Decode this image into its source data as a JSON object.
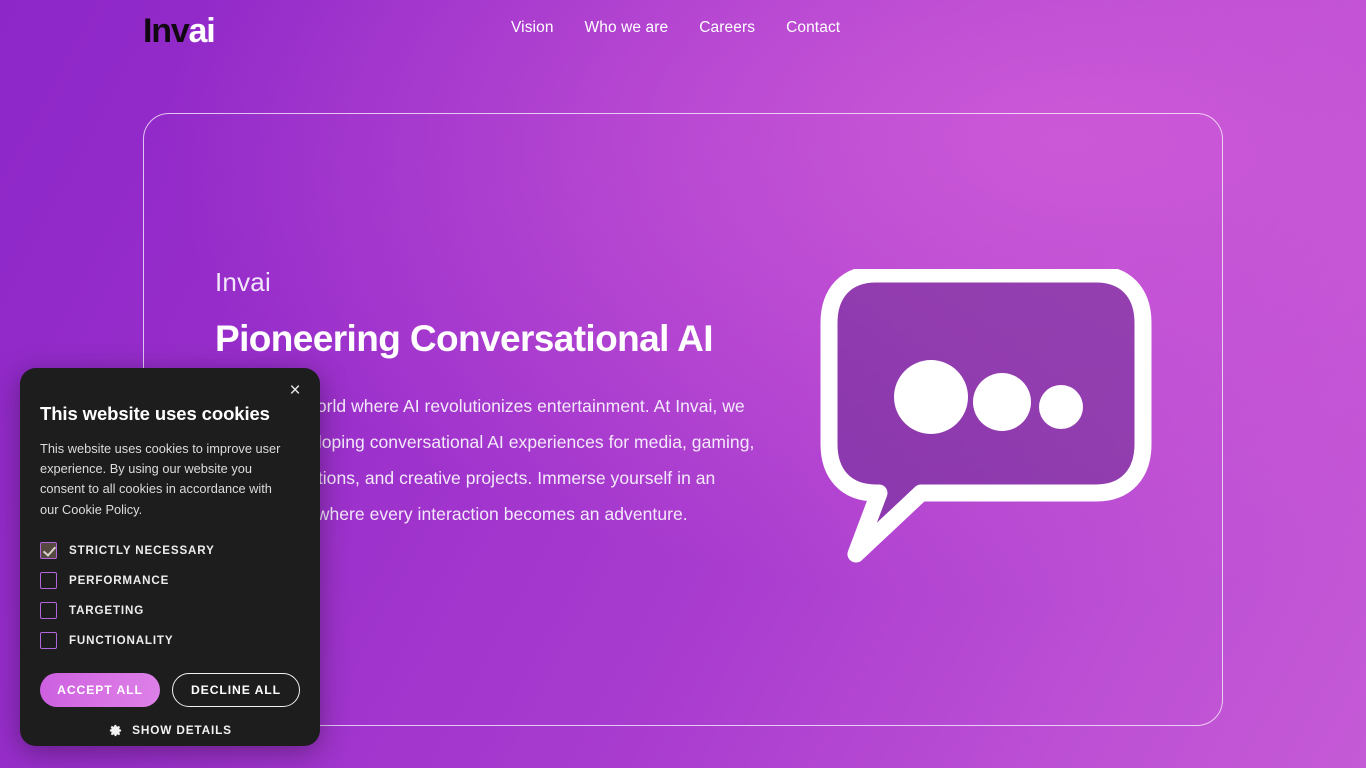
{
  "header": {
    "logo": {
      "dark_part": "Inv",
      "light_part": "ai"
    },
    "nav": [
      {
        "label": "Vision",
        "name": "nav-link-vision"
      },
      {
        "label": "Who we are",
        "name": "nav-link-who-we-are"
      },
      {
        "label": "Careers",
        "name": "nav-link-careers"
      },
      {
        "label": "Contact",
        "name": "nav-link-contact"
      }
    ]
  },
  "hero": {
    "eyebrow": "Invai",
    "title": "Pioneering Conversational AI",
    "paragraph": "Step into a world where AI revolutionizes entertainment. At Invai, we excel in developing conversational AI experiences for media, gaming, social interactions, and creative projects. Immerse yourself in an environment where every interaction becomes an adventure.",
    "illustration": "speech-bubble-typing-icon"
  },
  "cookie_banner": {
    "title": "This website uses cookies",
    "description": "This website uses cookies to improve user experience. By using our website you consent to all cookies in accordance with our Cookie Policy.",
    "close_label": "×",
    "options": [
      {
        "label": "Strictly Necessary",
        "checked": true
      },
      {
        "label": "Performance",
        "checked": false
      },
      {
        "label": "Targeting",
        "checked": false
      },
      {
        "label": "Functionality",
        "checked": false
      }
    ],
    "accept_label": "Accept all",
    "decline_label": "Decline all",
    "details_label": "Show details",
    "details_icon": "gear-icon"
  },
  "colors": {
    "background_start": "#8d27c8",
    "background_end": "#c55ad6",
    "accent_pink": "#d873e4",
    "banner_background": "#1d1d1d",
    "checkbox_border": "#b266dd",
    "checked_fill": "#55493f"
  }
}
